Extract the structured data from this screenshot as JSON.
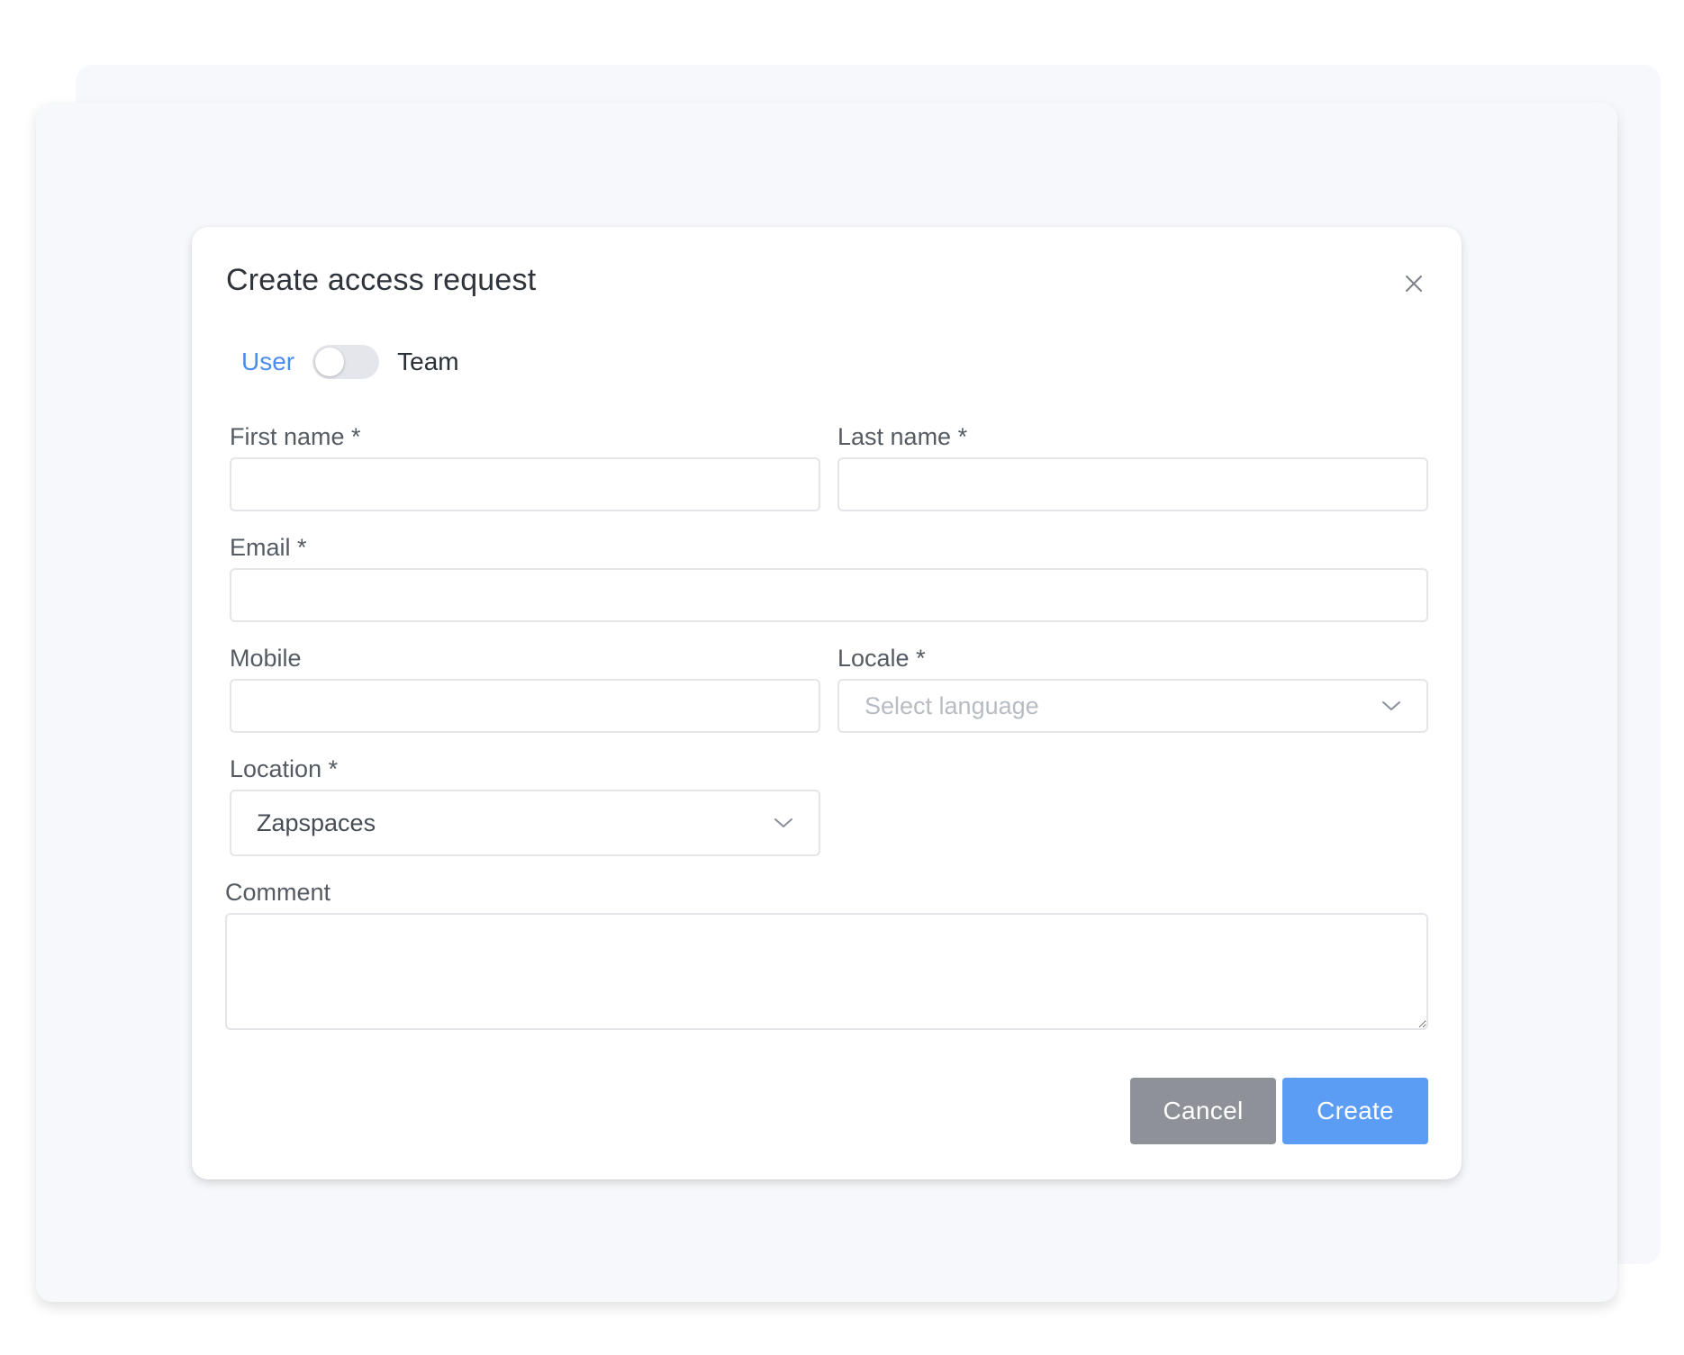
{
  "dialog": {
    "title": "Create access request"
  },
  "toggle": {
    "left_label": "User",
    "right_label": "Team",
    "selected": "User"
  },
  "fields": {
    "first_name": {
      "label": "First name *",
      "value": ""
    },
    "last_name": {
      "label": "Last name *",
      "value": ""
    },
    "email": {
      "label": "Email *",
      "value": ""
    },
    "mobile": {
      "label": "Mobile",
      "value": ""
    },
    "locale": {
      "label": "Locale *",
      "placeholder": "Select language"
    },
    "location": {
      "label": "Location *",
      "value": "Zapspaces"
    },
    "comment": {
      "label": "Comment",
      "value": ""
    }
  },
  "actions": {
    "cancel_label": "Cancel",
    "create_label": "Create"
  },
  "icons": {
    "close": "close-icon",
    "dropdown": "chevron-down-icon"
  },
  "colors": {
    "accent": "#5b9cf4",
    "toggle_active_label": "#4a8cf0",
    "cancel_button": "#8e9197"
  }
}
